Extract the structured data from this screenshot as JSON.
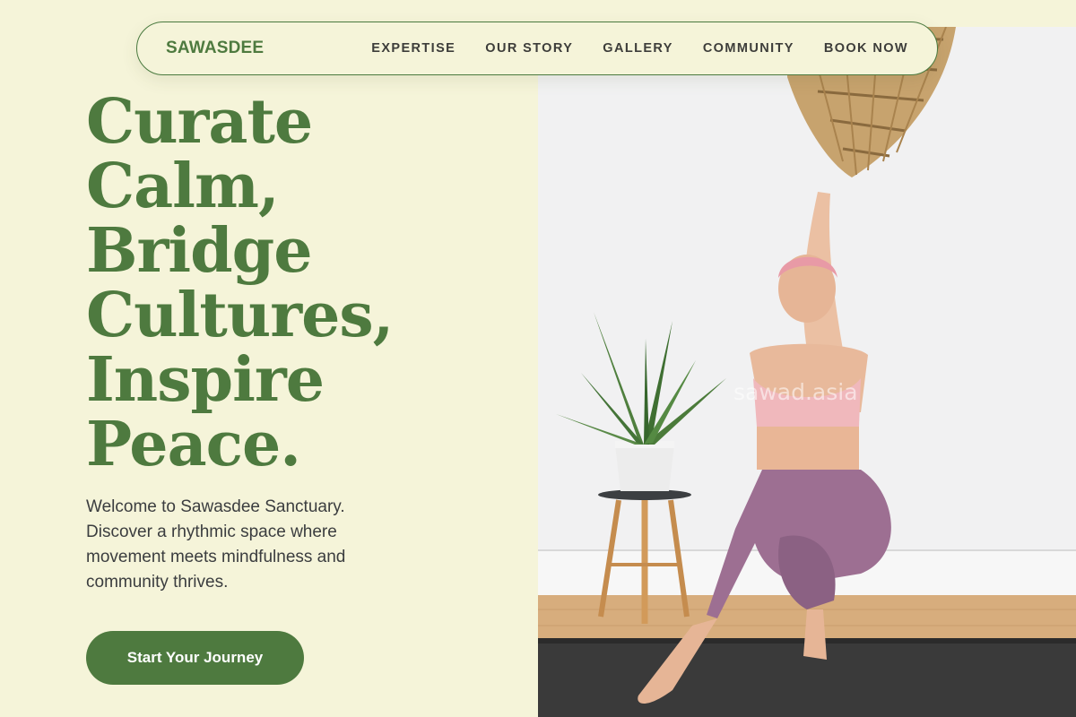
{
  "nav": {
    "brand": "SAWASDEE",
    "links": [
      "EXPERTISE",
      "OUR STORY",
      "GALLERY",
      "COMMUNITY",
      "BOOK NOW"
    ]
  },
  "hero": {
    "title_lines": [
      "Curate",
      "Calm,",
      "Bridge",
      "Cultures,",
      "Inspire",
      "Peace."
    ],
    "description": "Welcome to Sawasdee Sanctuary. Discover a rhythmic space where movement meets mindfulness and community thrives.",
    "cta_label": "Start Your Journey",
    "image": {
      "subject": "yoga-practitioner-eagle-pose",
      "watermark": "sawad.asia"
    }
  },
  "colors": {
    "background": "#f5f4d9",
    "brand_green": "#4e7a3f",
    "text_dark": "#3b3d3f"
  }
}
